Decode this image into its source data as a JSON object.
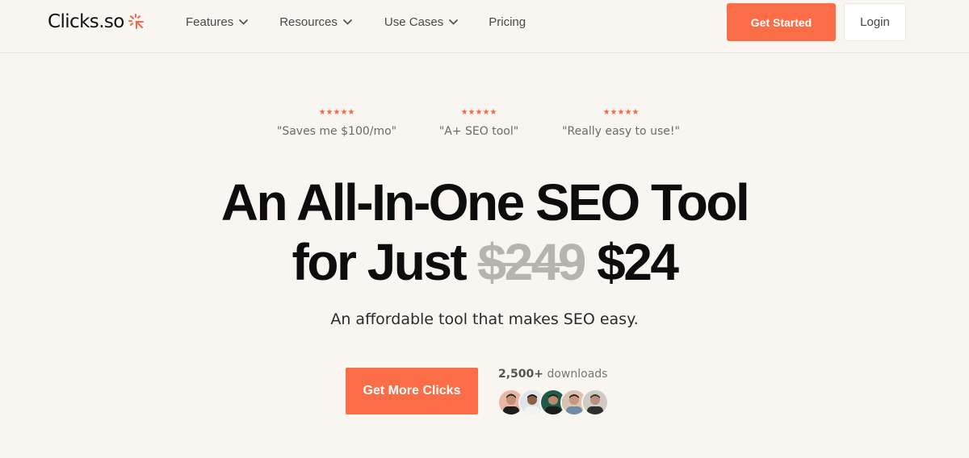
{
  "brand": {
    "name": "Clicks.so",
    "accent": "#fb6d47"
  },
  "nav": {
    "items": [
      {
        "label": "Features",
        "dropdown": true,
        "icon": "chevron-down-icon"
      },
      {
        "label": "Resources",
        "dropdown": true,
        "icon": "chevron-down-icon"
      },
      {
        "label": "Use Cases",
        "dropdown": true,
        "icon": "chevron-down-icon"
      },
      {
        "label": "Pricing",
        "dropdown": false
      }
    ],
    "get_started_label": "Get Started",
    "login_label": "Login"
  },
  "testimonials": [
    {
      "rating": 5,
      "quote": "\"Saves me $100/mo\""
    },
    {
      "rating": 5,
      "quote": "\"A+ SEO tool\""
    },
    {
      "rating": 5,
      "quote": "\"Really easy to use!\""
    }
  ],
  "hero": {
    "headline_line1": "An All-In-One SEO Tool",
    "headline_line2_prefix": "for Just",
    "old_price": "$249",
    "new_price": "$24",
    "subheadline": "An affordable tool that makes SEO easy."
  },
  "cta": {
    "button_label": "Get More Clicks",
    "downloads_count": "2,500+",
    "downloads_label": "downloads",
    "avatar_count": 5
  }
}
